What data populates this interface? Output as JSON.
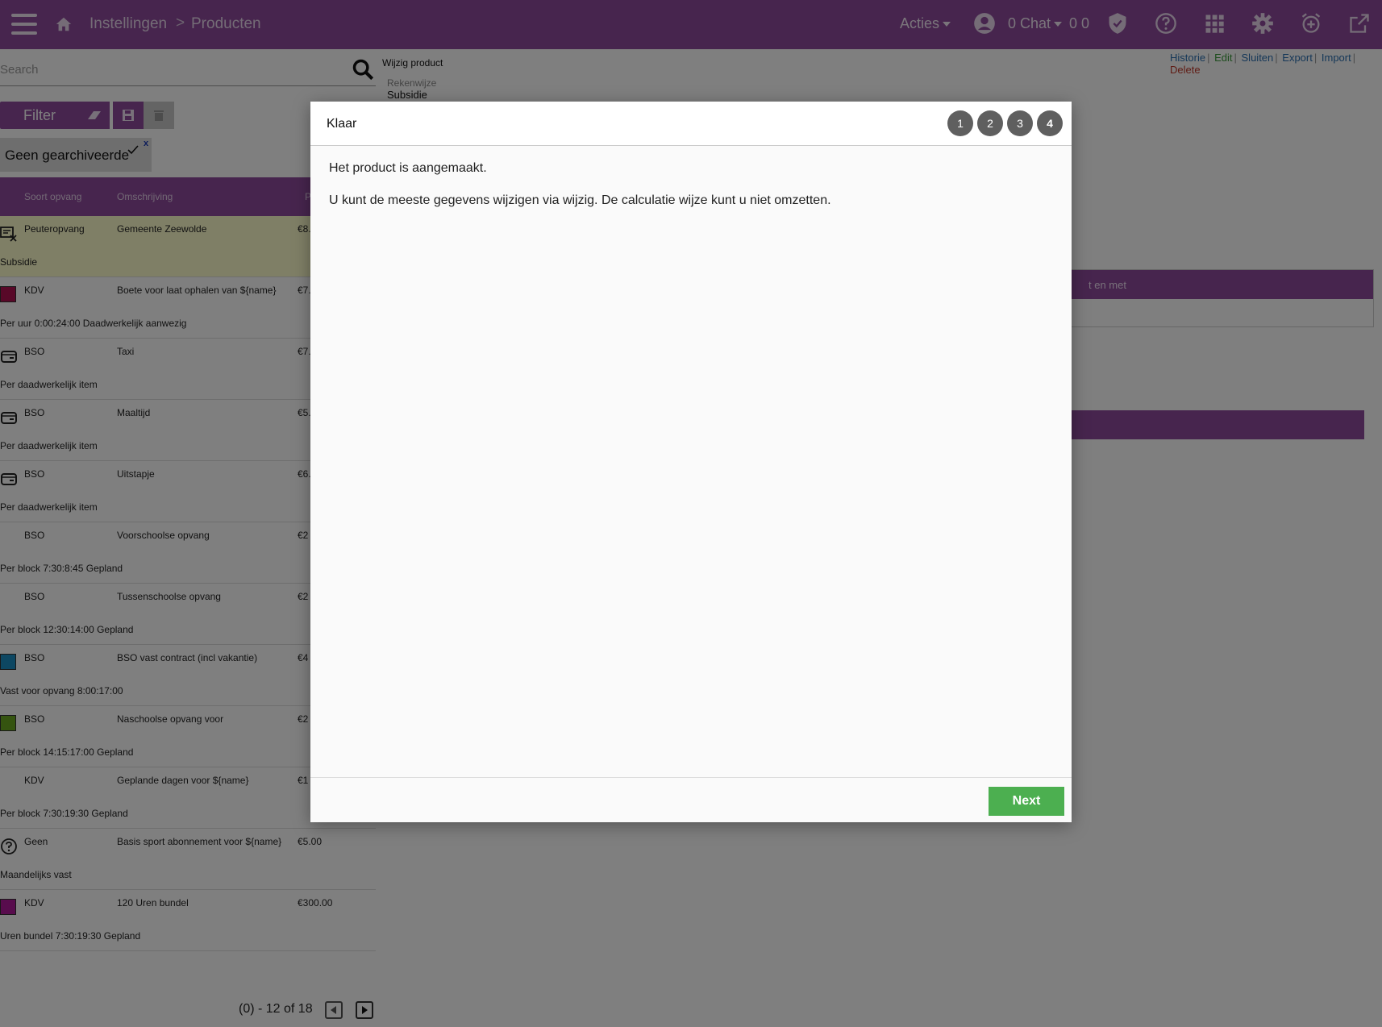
{
  "header": {
    "breadcrumb": [
      "Instellingen",
      "Producten"
    ],
    "acties_label": "Acties",
    "chat_label": "0 Chat",
    "counts": "0 0",
    "bar_color": "#8e4a9c",
    "icons": [
      "hamburger-icon",
      "home-icon",
      "user-icon",
      "shield-icon",
      "help-icon",
      "apps-icon",
      "gear-icon",
      "alarm-icon",
      "external-link-icon"
    ]
  },
  "search": {
    "placeholder": "Search"
  },
  "toolbar": {
    "filter_label": "Filter"
  },
  "filter_chip": {
    "label": "Geen gearchiveerde",
    "close": "x"
  },
  "table": {
    "headers": [
      "Soort opvang",
      "Omschrijving",
      "P"
    ],
    "rows": [
      {
        "type": "Peuteropvang",
        "desc": "Gemeente Zeewolde",
        "price": "€8.",
        "sub": "Subsidie",
        "icon": "subsidy-icon"
      },
      {
        "type": "KDV",
        "desc": "Boete voor laat ophalen van ${name}",
        "price": "€7.",
        "sub": "Per uur 0:00:24:00 Daadwerkelijk aanwezig",
        "swatch": "#b01050"
      },
      {
        "type": "BSO",
        "desc": "Taxi",
        "price": "€7.",
        "sub": "Per daadwerkelijk item",
        "icon": "wallet-icon"
      },
      {
        "type": "BSO",
        "desc": "Maaltijd",
        "price": "€5.",
        "sub": "Per daadwerkelijk item",
        "icon": "wallet-icon"
      },
      {
        "type": "BSO",
        "desc": "Uitstapje",
        "price": "€6.",
        "sub": "Per daadwerkelijk item",
        "icon": "wallet-icon"
      },
      {
        "type": "BSO",
        "desc": "Voorschoolse opvang",
        "price": "€2",
        "sub": "Per block 7:30:8:45 Gepland"
      },
      {
        "type": "BSO",
        "desc": "Tussenschoolse opvang",
        "price": "€2",
        "sub": "Per block 12:30:14:00 Gepland"
      },
      {
        "type": "BSO",
        "desc": "BSO vast contract (incl vakantie)",
        "price": "€4",
        "sub": "Vast voor opvang 8:00:17:00",
        "swatch": "#1a8fc4"
      },
      {
        "type": "BSO",
        "desc": "Naschoolse opvang voor",
        "price": "€2",
        "sub": "Per block 14:15:17:00 Gepland",
        "swatch": "#6aa821"
      },
      {
        "type": "KDV",
        "desc": "Geplande dagen voor ${name}",
        "price": "€1",
        "sub": "Per block 7:30:19:30 Gepland"
      },
      {
        "type": "Geen",
        "desc": "Basis sport abonnement voor ${name}",
        "price": "€5.00",
        "sub": "Maandelijks vast",
        "icon": "question-icon"
      },
      {
        "type": "KDV",
        "desc": "120 Uren bundel",
        "price": "€300.00",
        "sub": "Uren bundel 7:30:19:30 Gepland",
        "swatch": "#b0199a"
      }
    ]
  },
  "pager": {
    "text": "(0) - 12 of 18"
  },
  "detail": {
    "title": "Wijzig product",
    "field_label": "Rekenwijze",
    "field_value": "Subsidie",
    "panel_header": "t en met",
    "actions": [
      {
        "label": "Historie",
        "color": "#2a6fb0"
      },
      {
        "label": "Edit",
        "color": "#3a9a3a"
      },
      {
        "label": "Sluiten",
        "color": "#2a6fb0"
      },
      {
        "label": "Export",
        "color": "#2a6fb0"
      },
      {
        "label": "Import",
        "color": "#2a6fb0"
      },
      {
        "label": "Delete",
        "color": "#c0392b"
      }
    ]
  },
  "modal": {
    "title": "Klaar",
    "steps": [
      "1",
      "2",
      "3",
      "4"
    ],
    "active_step": 4,
    "message1": "Het product is aangemaakt.",
    "message2": "U kunt de meeste gegevens wijzigen via wijzig. De calculatie wijze kunt u niet omzetten.",
    "next_label": "Next",
    "next_color": "#4caf50"
  }
}
